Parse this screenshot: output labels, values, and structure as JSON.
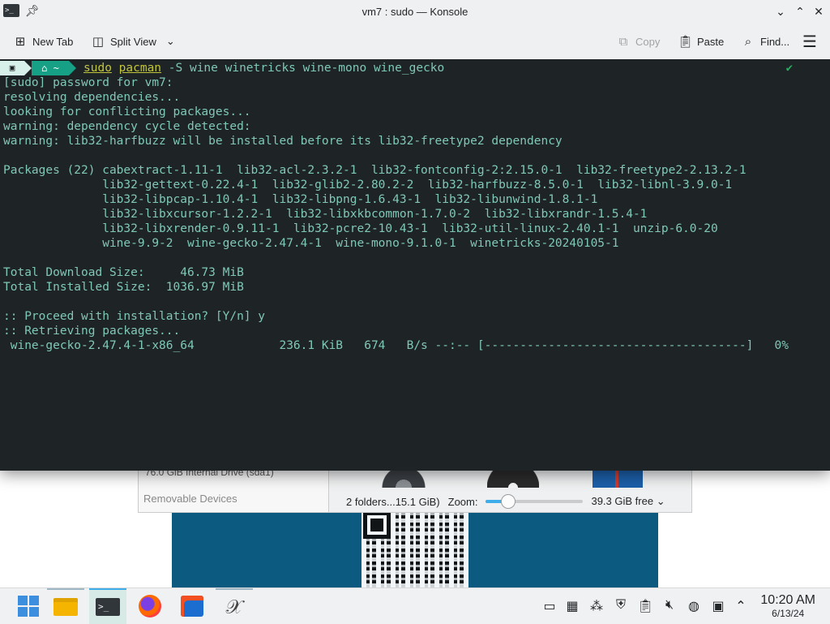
{
  "window": {
    "title": "vm7 : sudo — Konsole"
  },
  "toolbar": {
    "new_tab": "New Tab",
    "split_view": "Split View",
    "copy": "Copy",
    "paste": "Paste",
    "find": "Find..."
  },
  "terminal": {
    "prompt_dir": "~",
    "command": {
      "sudo": "sudo",
      "pacman": "pacman",
      "args": " -S wine winetricks wine-mono wine_gecko"
    },
    "lines": [
      "[sudo] password for vm7:",
      "resolving dependencies...",
      "looking for conflicting packages...",
      "warning: dependency cycle detected:",
      "warning: lib32-harfbuzz will be installed before its lib32-freetype2 dependency",
      "",
      "Packages (22) cabextract-1.11-1  lib32-acl-2.3.2-1  lib32-fontconfig-2:2.15.0-1  lib32-freetype2-2.13.2-1",
      "              lib32-gettext-0.22.4-1  lib32-glib2-2.80.2-2  lib32-harfbuzz-8.5.0-1  lib32-libnl-3.9.0-1",
      "              lib32-libpcap-1.10.4-1  lib32-libpng-1.6.43-1  lib32-libunwind-1.8.1-1",
      "              lib32-libxcursor-1.2.2-1  lib32-libxkbcommon-1.7.0-2  lib32-libxrandr-1.5.4-1",
      "              lib32-libxrender-0.9.11-1  lib32-pcre2-10.43-1  lib32-util-linux-2.40.1-1  unzip-6.0-20",
      "              wine-9.9-2  wine-gecko-2.47.4-1  wine-mono-9.1.0-1  winetricks-20240105-1",
      "",
      "Total Download Size:     46.73 MiB",
      "Total Installed Size:  1036.97 MiB",
      "",
      ":: Proceed with installation? [Y/n] y",
      ":: Retrieving packages...",
      " wine-gecko-2.47.4-1-x86_64            236.1 KiB   674   B/s --:-- [-------------------------------------]   0%"
    ]
  },
  "dolphin": {
    "drive_label": "76.0 GiB Internal Drive (sda1)",
    "removable_devices": "Removable Devices",
    "status": "2 folders...15.1 GiB)",
    "zoom_label": "Zoom:",
    "zoom_level": 0.22,
    "free_space": "39.3 GiB free"
  },
  "taskbar": {
    "time": "10:20 AM",
    "date": "6/13/24"
  },
  "colors": {
    "terminal_bg": "#1e2326",
    "terminal_fg": "#7fc8b7",
    "accent": "#3daee9"
  }
}
